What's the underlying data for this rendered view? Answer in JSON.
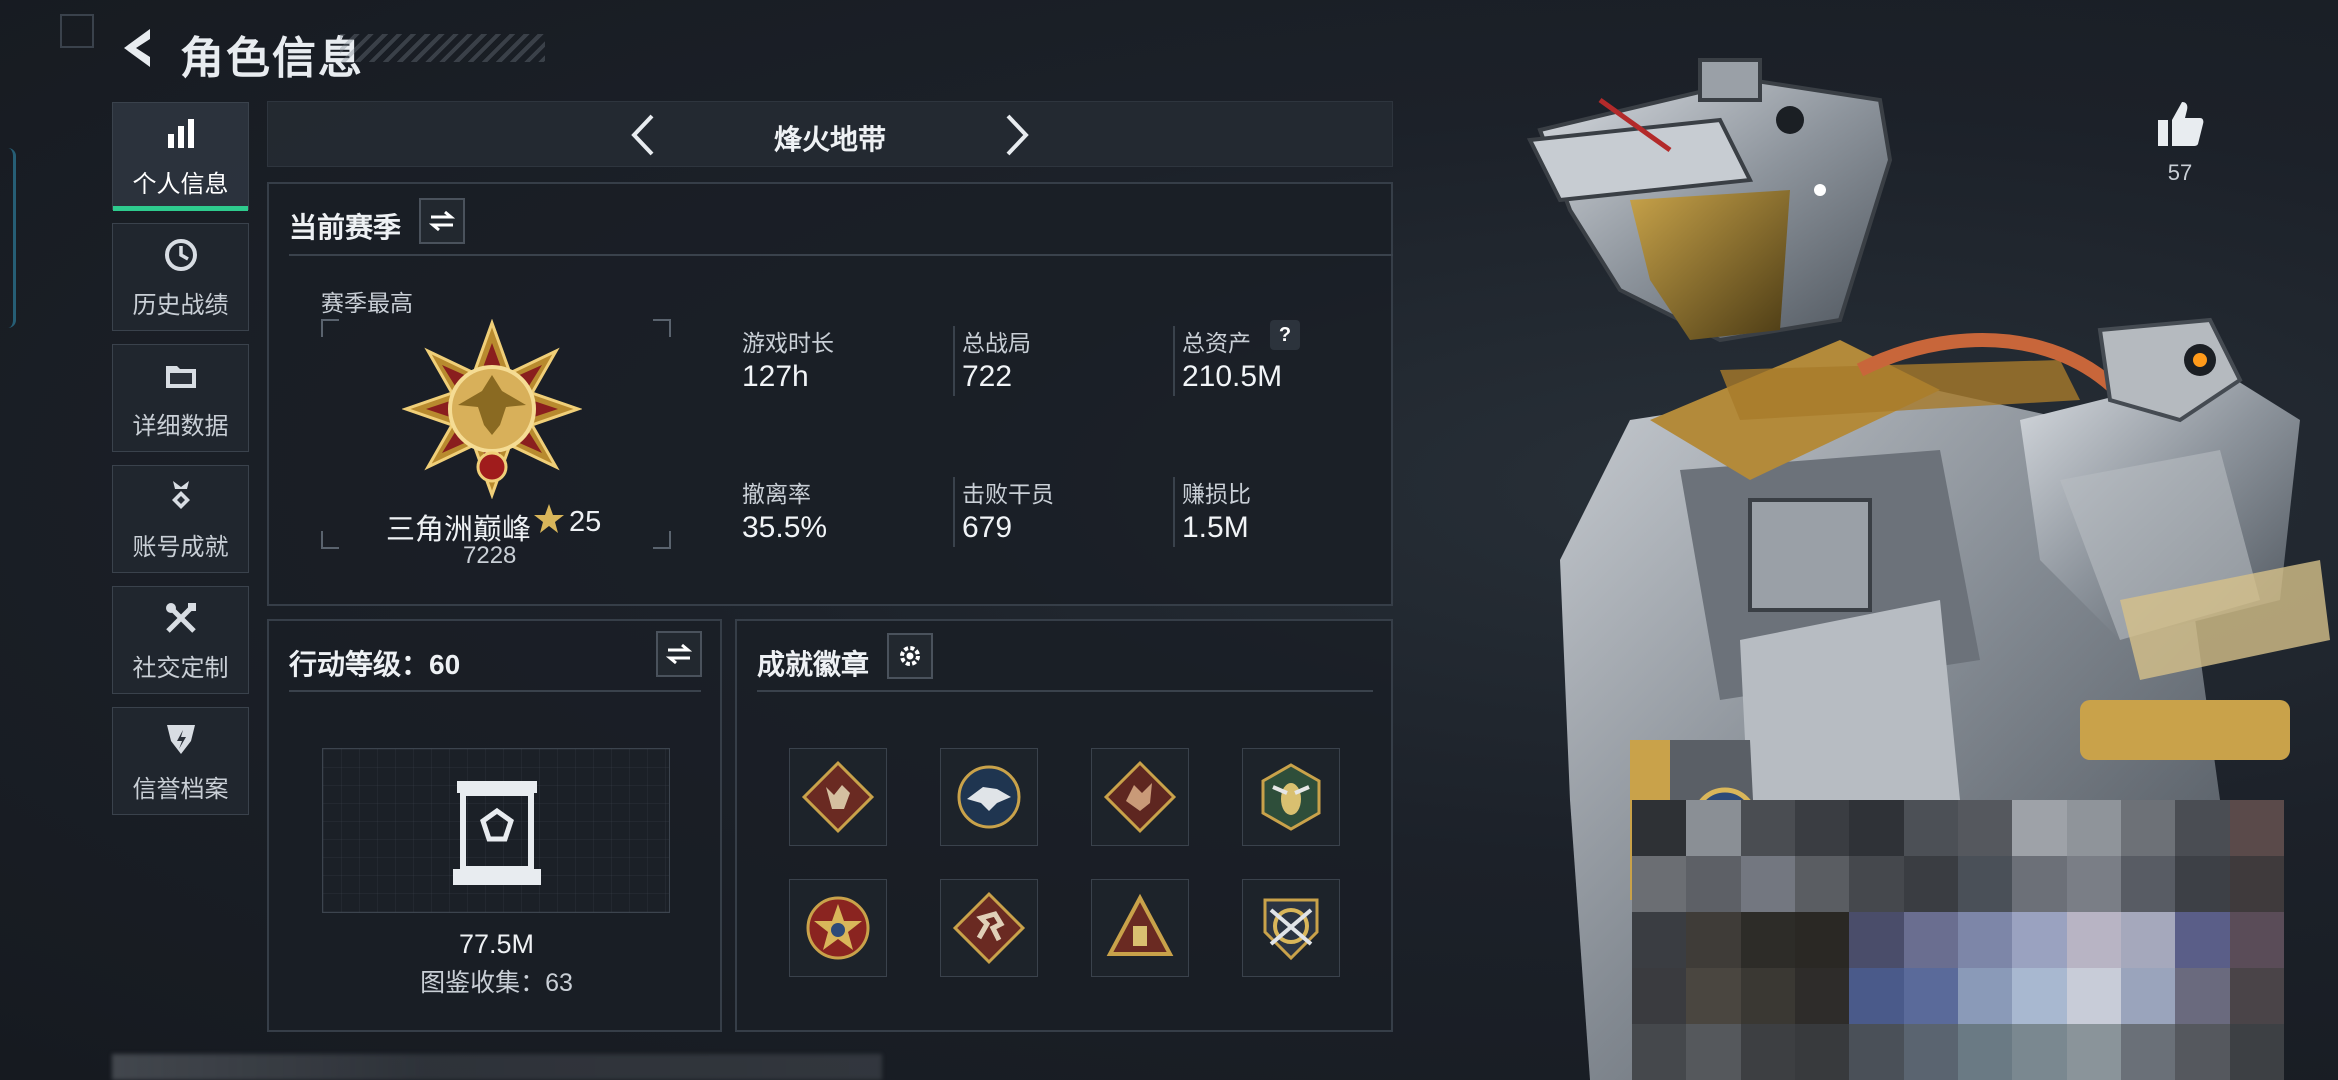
{
  "header": {
    "title": "角色信息"
  },
  "sidebar": {
    "items": [
      {
        "label": "个人信息",
        "icon": "bar-chart-icon",
        "active": true
      },
      {
        "label": "历史战绩",
        "icon": "clock-icon",
        "active": false
      },
      {
        "label": "详细数据",
        "icon": "folder-icon",
        "active": false
      },
      {
        "label": "账号成就",
        "icon": "medal-icon",
        "active": false
      },
      {
        "label": "社交定制",
        "icon": "tools-icon",
        "active": false
      },
      {
        "label": "信誉档案",
        "icon": "shield-icon",
        "active": false
      }
    ]
  },
  "map_selector": {
    "current": "烽火地带"
  },
  "season": {
    "title": "当前赛季",
    "best_label": "赛季最高",
    "rank_name": "三角洲巅峰",
    "rank_level": "25",
    "rank_score": "7228",
    "stats": [
      {
        "label": "游戏时长",
        "value": "127h"
      },
      {
        "label": "总战局",
        "value": "722"
      },
      {
        "label": "总资产",
        "value": "210.5M",
        "help": "?"
      },
      {
        "label": "撤离率",
        "value": "35.5%"
      },
      {
        "label": "击败干员",
        "value": "679"
      },
      {
        "label": "赚损比",
        "value": "1.5M"
      }
    ]
  },
  "action_level": {
    "title": "行动等级：60",
    "value": "77.5M",
    "collection": "图鉴收集：63"
  },
  "achievements": {
    "title": "成就徽章",
    "badges": [
      "wolf-badge-icon",
      "eagle-badge-icon",
      "dragon-badge-icon",
      "wasp-badge-icon",
      "star-badge-icon",
      "runner-badge-icon",
      "pyramid-badge-icon",
      "crossed-guns-badge-icon"
    ]
  },
  "likes": {
    "count": "57"
  },
  "colors": {
    "accent": "#2ecb8e",
    "panel_border": "#363e48",
    "background": "#1c2129",
    "gold": "#c9a24a"
  }
}
